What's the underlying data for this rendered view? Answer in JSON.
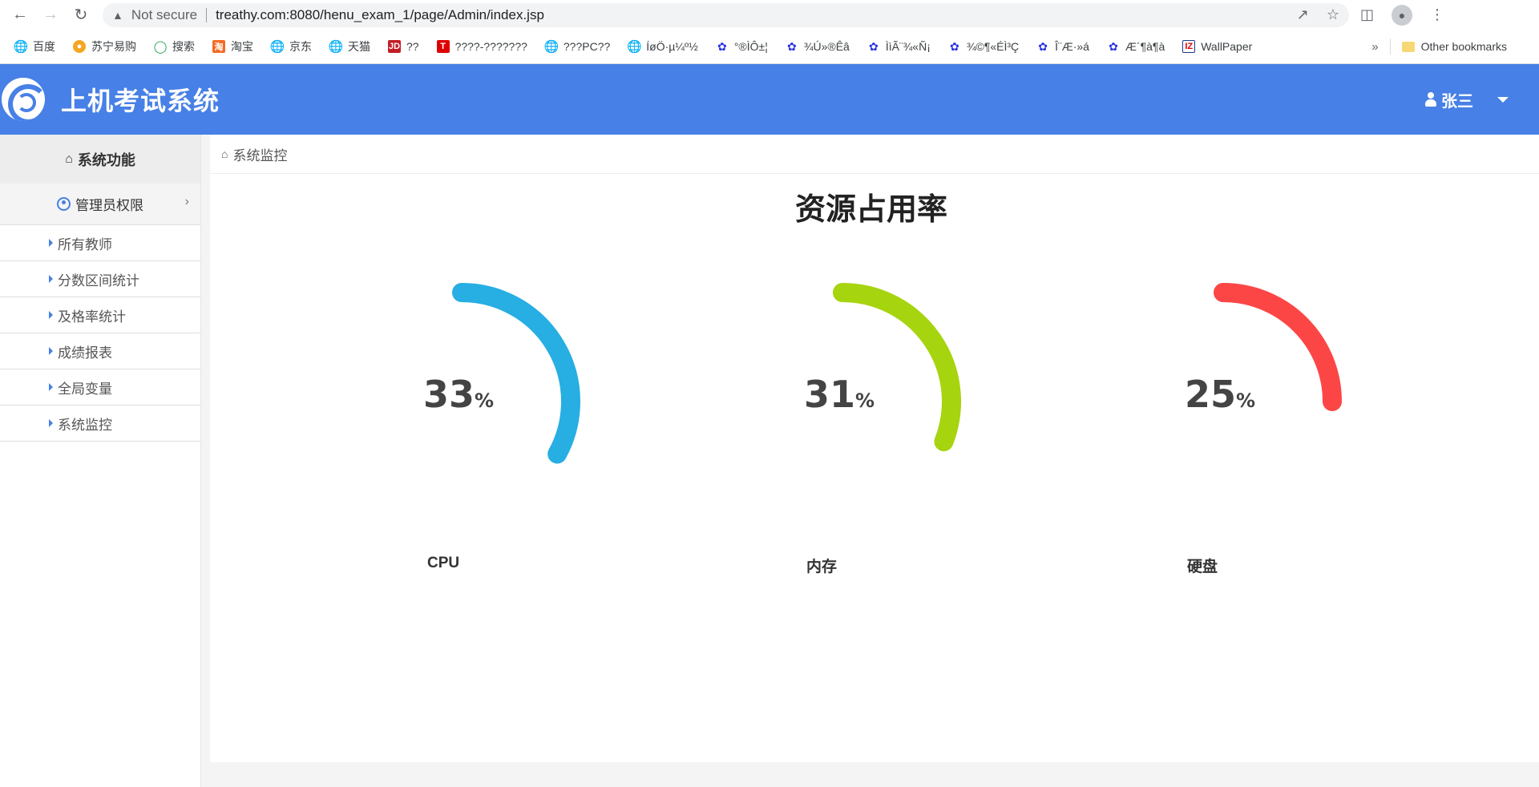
{
  "browser": {
    "security_label": "Not secure",
    "url": "treathy.com:8080/henu_exam_1/page/Admin/index.jsp",
    "bookmarks": [
      {
        "label": "百度",
        "icon": "globe-icon"
      },
      {
        "label": "苏宁易购",
        "icon": "suning-icon"
      },
      {
        "label": "搜索",
        "icon": "search-icon"
      },
      {
        "label": "淘宝",
        "icon": "taobao-icon"
      },
      {
        "label": "京东",
        "icon": "globe-icon"
      },
      {
        "label": "天猫",
        "icon": "globe-icon"
      },
      {
        "label": "??",
        "icon": "jd-icon"
      },
      {
        "label": "????-???????",
        "icon": "t-icon"
      },
      {
        "label": "???PC??",
        "icon": "globe-icon"
      },
      {
        "label": "ÍøÖ·µ¼º½",
        "icon": "globe-icon"
      },
      {
        "label": "°®ÌÔ±¦",
        "icon": "paw-icon"
      },
      {
        "label": "¾Ú»®Êâ",
        "icon": "paw-icon"
      },
      {
        "label": "ÌìÃ¨¾«Ñ¡",
        "icon": "paw-icon"
      },
      {
        "label": "¾©¶«ÉÌ³Ç",
        "icon": "paw-icon"
      },
      {
        "label": "Î¨Æ·»á",
        "icon": "paw-icon"
      },
      {
        "label": "Æ´¶à¶à",
        "icon": "paw-icon"
      },
      {
        "label": "WallPaper",
        "icon": "wallpaper-icon"
      }
    ],
    "more_label": "»",
    "other_bookmarks": "Other bookmarks"
  },
  "header": {
    "title": "上机考试系统",
    "user": "张三",
    "color": "#4780e6"
  },
  "sidebar": {
    "heading": "系统功能",
    "group": "管理员权限",
    "items": [
      {
        "label": "所有教师"
      },
      {
        "label": "分数区间统计"
      },
      {
        "label": "及格率统计"
      },
      {
        "label": "成绩报表"
      },
      {
        "label": "全局变量"
      },
      {
        "label": "系统监控"
      }
    ]
  },
  "main": {
    "breadcrumb": "系统监控",
    "title": "资源占用率",
    "gauges": [
      {
        "label": "CPU",
        "value": "33",
        "unit": "%",
        "color": "#27aee3"
      },
      {
        "label": "内存",
        "value": "31",
        "unit": "%",
        "color": "#a6d40f"
      },
      {
        "label": "硬盘",
        "value": "25",
        "unit": "%",
        "color": "#fc4646"
      }
    ]
  }
}
